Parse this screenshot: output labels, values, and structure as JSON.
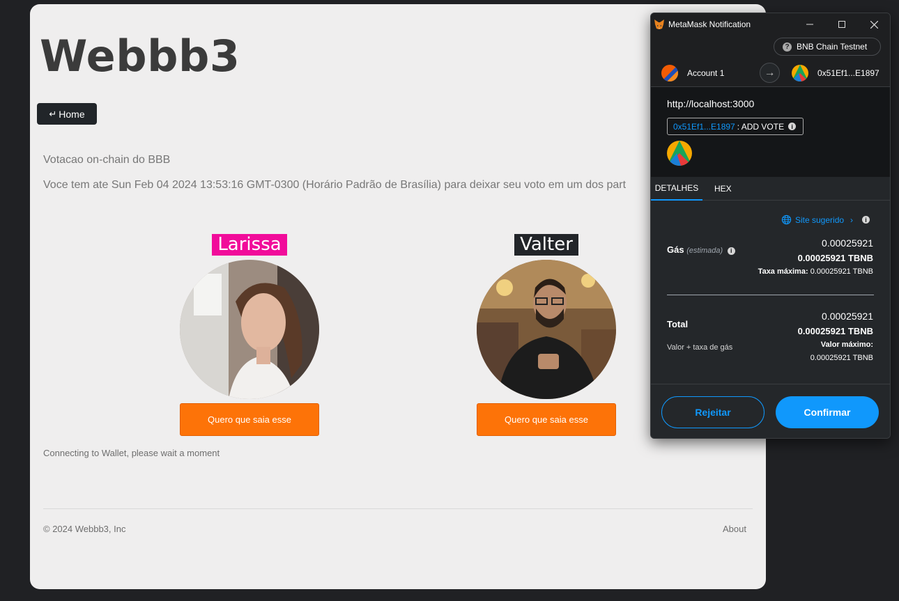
{
  "site": {
    "title": "Webbb3",
    "home_button": "Home",
    "description": "Votacao on-chain do BBB",
    "deadline_text": "Voce tem ate Sun Feb 04 2024 13:53:16 GMT-0300 (Horário Padrão de Brasília) para deixar seu voto em um dos part",
    "candidates": [
      {
        "name": "Larissa",
        "vote_label": "Quero que saia esse",
        "name_color": "#f10c9a"
      },
      {
        "name": "Valter",
        "vote_label": "Quero que saia esse",
        "name_color": "#222529"
      }
    ],
    "status": "Connecting to Wallet, please wait a moment",
    "footer": {
      "copyright": "© 2024 Webbb3, Inc",
      "about": "About"
    },
    "accent_color": "#fd7308"
  },
  "metamask": {
    "window_title": "MetaMask Notification",
    "network": "BNB Chain Testnet",
    "from_account": "Account 1",
    "to_address": "0x51Ef1...E1897",
    "origin": "http://localhost:3000",
    "method_address": "0x51Ef1...E1897",
    "method_name": ": ADD VOTE",
    "tabs": {
      "details": "DETALHES",
      "hex": "HEX"
    },
    "suggested_site": "Site sugerido",
    "gas": {
      "label": "Gás",
      "estimated": "(estimada)",
      "value": "0.00025921",
      "value_token": "0.00025921 TBNB",
      "max_label": "Taxa máxima:",
      "max_value": "0.00025921 TBNB"
    },
    "total": {
      "label": "Total",
      "sublabel": "Valor + taxa de gás",
      "value": "0.00025921",
      "value_token": "0.00025921 TBNB",
      "max_label": "Valor máximo:",
      "max_value": "0.00025921 TBNB"
    },
    "reject_label": "Rejeitar",
    "confirm_label": "Confirmar",
    "accent_color": "#1098fc"
  }
}
